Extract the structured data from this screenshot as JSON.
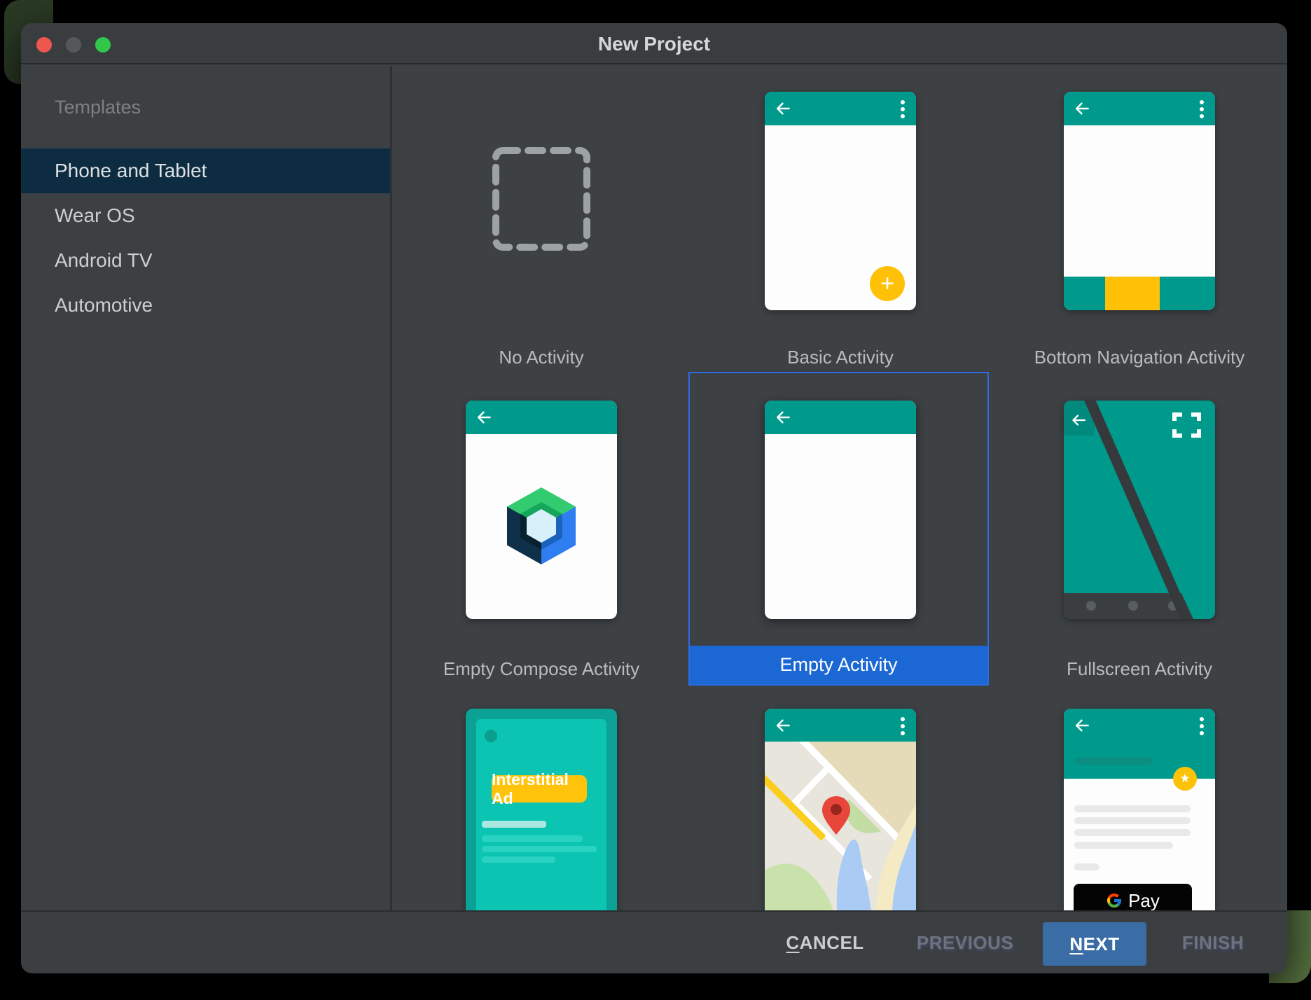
{
  "window": {
    "title": "New Project"
  },
  "sidebar": {
    "header": "Templates",
    "items": [
      {
        "label": "Phone and Tablet",
        "selected": true
      },
      {
        "label": "Wear OS",
        "selected": false
      },
      {
        "label": "Android TV",
        "selected": false
      },
      {
        "label": "Automotive",
        "selected": false
      }
    ]
  },
  "templates": {
    "row1": [
      {
        "name": "No Activity"
      },
      {
        "name": "Basic Activity"
      },
      {
        "name": "Bottom Navigation Activity"
      }
    ],
    "row2": [
      {
        "name": "Empty Compose Activity"
      },
      {
        "name": "Empty Activity",
        "selected": true
      },
      {
        "name": "Fullscreen Activity"
      }
    ],
    "row3": {
      "ads_badge": "Interstitial Ad",
      "gpay_label": "Pay"
    }
  },
  "footer": {
    "cancel": {
      "label": "CANCEL",
      "mnemonic": "C"
    },
    "previous": {
      "label": "PREVIOUS"
    },
    "next": {
      "label": "NEXT",
      "mnemonic": "N"
    },
    "finish": {
      "label": "FINISH"
    }
  },
  "colors": {
    "teal_header": "#009a8c",
    "amber": "#ffc107",
    "selection_blue": "#1b67d4",
    "selection_border": "#2b6ce2",
    "sidebar_selection": "#0d2c42",
    "next_button": "#3a6da5"
  }
}
